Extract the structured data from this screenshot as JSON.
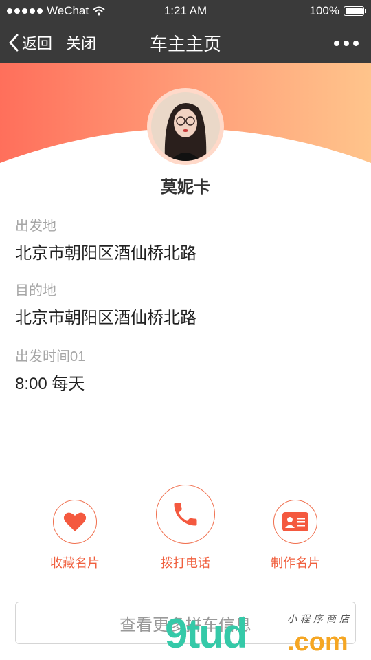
{
  "status_bar": {
    "carrier": "WeChat",
    "time": "1:21 AM",
    "battery": "100%"
  },
  "nav": {
    "back": "返回",
    "close": "关闭",
    "title": "车主主页"
  },
  "profile": {
    "name": "莫妮卡"
  },
  "info": [
    {
      "label": "出发地",
      "value": "北京市朝阳区酒仙桥北路"
    },
    {
      "label": "目的地",
      "value": "北京市朝阳区酒仙桥北路"
    },
    {
      "label": "出发时间01",
      "value": "8:00 每天"
    }
  ],
  "actions": [
    {
      "label": "收藏名片",
      "icon": "heart-icon"
    },
    {
      "label": "拨打电话",
      "icon": "phone-icon"
    },
    {
      "label": "制作名片",
      "icon": "business-card-icon"
    }
  ],
  "more_button": "查看更多拼车信息",
  "watermark": {
    "main": "9tud",
    "suffix": ".com",
    "tagline": "小程序商店"
  },
  "colors": {
    "accent": "#f0603f",
    "nav_bg": "#3a3a3a",
    "gradient_start": "#ff6f5b",
    "gradient_end": "#ffc48b"
  }
}
